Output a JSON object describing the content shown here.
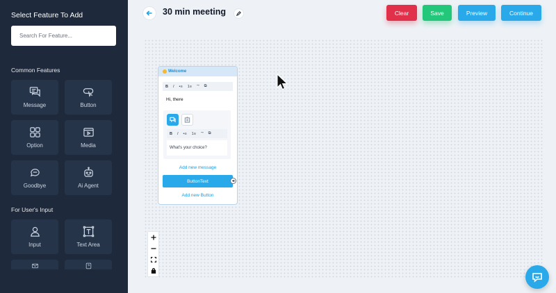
{
  "sidebar": {
    "title": "Select Feature To Add",
    "search_placeholder": "Search For Feature...",
    "common_section": "Common Features",
    "common_items": [
      {
        "label": "Message",
        "icon": "message-icon"
      },
      {
        "label": "Button",
        "icon": "button-icon"
      },
      {
        "label": "Option",
        "icon": "option-icon"
      },
      {
        "label": "Media",
        "icon": "media-icon"
      },
      {
        "label": "Goodbye",
        "icon": "goodbye-icon"
      },
      {
        "label": "Ai Agent",
        "icon": "ai-agent-icon"
      }
    ],
    "input_section": "For User's Input",
    "input_items": [
      {
        "label": "Input",
        "icon": "user-icon"
      },
      {
        "label": "Text Area",
        "icon": "text-area-icon"
      }
    ]
  },
  "header": {
    "title": "30 min meeting",
    "buttons": {
      "clear": "Clear",
      "save": "Save",
      "preview": "Preview",
      "continue": "Continue"
    },
    "colors": {
      "clear": "#e0304a",
      "save": "#22c77a",
      "primary": "#29a9ea"
    }
  },
  "node": {
    "header": "Welcome",
    "toolbar": [
      "B",
      "I",
      "•≡",
      "1≡",
      "“”",
      "⧉"
    ],
    "message": "Hi, there",
    "choice_placeholder": "What's your choice?",
    "add_message": "Add new message",
    "button_text": "ButtonText",
    "add_button": "Add new Button"
  }
}
